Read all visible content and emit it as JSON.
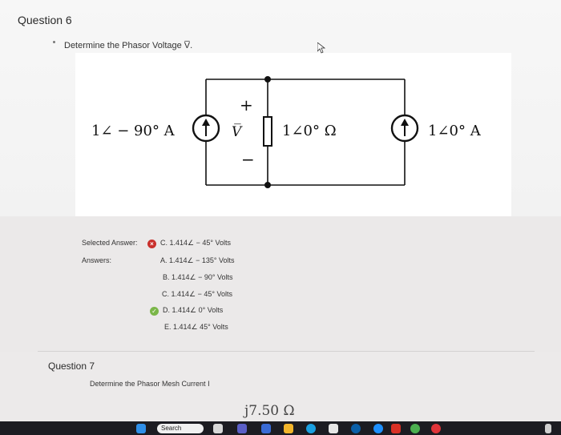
{
  "question": {
    "header": "Question 6",
    "prompt": "Determine the Phasor Voltage V̅."
  },
  "circuit": {
    "left_source_label": "1∠ − 90° A",
    "voltage_symbol": "V̅",
    "plus_sign": "+",
    "minus_sign": "−",
    "resistor_label": "1∠0° Ω",
    "right_source_label": "1∠0° A"
  },
  "result": {
    "selected_label": "Selected Answer:",
    "selected_value": "C. 1.414∠ − 45° Volts",
    "answers_label": "Answers:",
    "answers": [
      "A. 1.414∠ − 135° Volts",
      "B. 1.414∠ − 90° Volts",
      "C. 1.414∠ − 45° Volts",
      "D. 1.414∠ 0° Volts",
      "E. 1.414∠ 45° Volts"
    ],
    "wrong_mark": "×",
    "right_mark": "✓"
  },
  "next_question": {
    "header": "Question 7",
    "prompt": "Determine the Phasor Mesh Current I",
    "partial_value": "j7.50 Ω"
  },
  "taskbar": {
    "search_label": "Search"
  },
  "colors": {
    "wrong": "#c9302c",
    "correct": "#7ab648",
    "taskbar": "#1c1c22"
  }
}
